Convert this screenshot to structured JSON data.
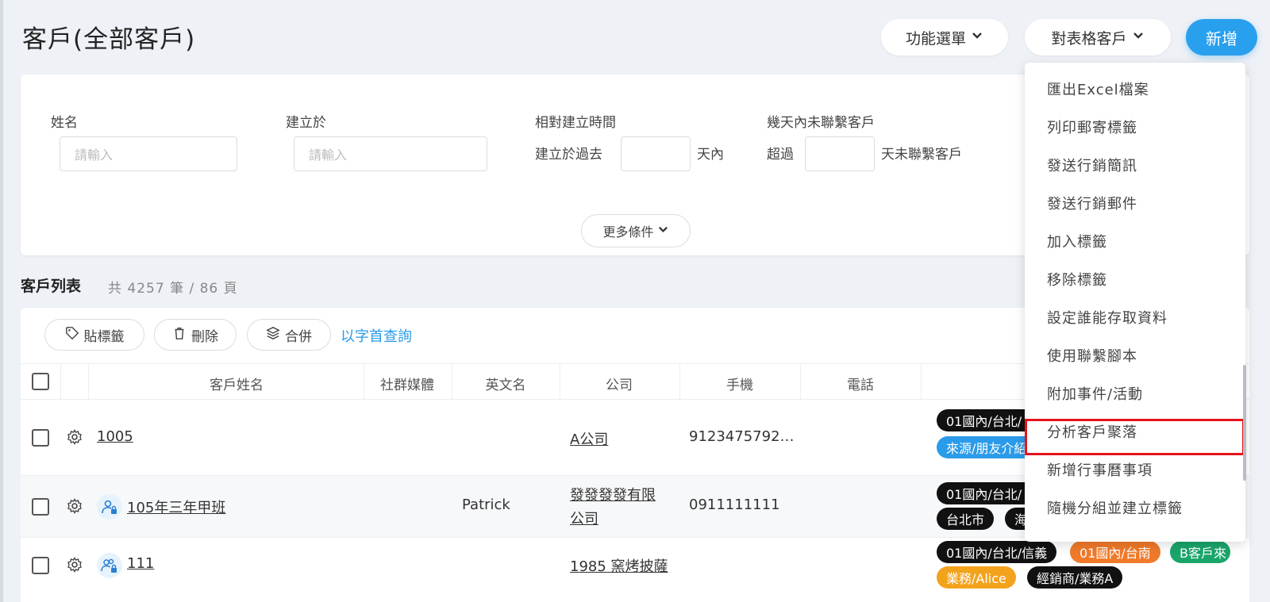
{
  "header": {
    "title": "客戶(全部客戶)",
    "func_menu_label": "功能選單",
    "table_menu_label": "對表格客戶",
    "add_label": "新增"
  },
  "filters": {
    "name_label": "姓名",
    "name_placeholder": "請輸入",
    "created_label": "建立於",
    "created_placeholder": "請輸入",
    "relative_label": "相對建立時間",
    "relative_prefix": "建立於過去",
    "relative_suffix": "天內",
    "uncontacted_label": "幾天內未聯繫客戶",
    "uncontacted_prefix": "超過",
    "uncontacted_suffix": "天未聯繫客戶",
    "more_label": "更多條件"
  },
  "list": {
    "title": "客戶列表",
    "count": "共 4257 筆 / 86 頁",
    "toolbar": {
      "tag_label": "貼標籤",
      "delete_label": "刪除",
      "merge_label": "合併",
      "alpha_label": "以字首查詢"
    },
    "columns": [
      "客戶姓名",
      "社群媒體",
      "英文名",
      "公司",
      "手機",
      "電話"
    ],
    "rows": [
      {
        "name": "1005",
        "english": "",
        "company": "A公司",
        "company_line2": "",
        "mobile": "9123475792…",
        "tags": [
          "01國內/台北/",
          "來源/朋友介紹"
        ]
      },
      {
        "name": "105年三年甲班",
        "english": "Patrick",
        "company": "發發發發有限",
        "company_line2": "公司",
        "mobile": "0911111111",
        "tags": [
          "01國內/台北/",
          "台北市",
          "海"
        ]
      },
      {
        "name": "111",
        "english": "",
        "company": "1985 窯烤披薩",
        "company_line2": "",
        "mobile": "",
        "tags": [
          "01國內/台北/信義",
          "01國內/台南",
          "B客戶來",
          "業務/Alice",
          "經銷商/業務A"
        ]
      }
    ]
  },
  "dropdown": {
    "items": [
      "匯出Excel檔案",
      "列印郵寄標籤",
      "發送行銷簡訊",
      "發送行銷郵件",
      "加入標籤",
      "移除標籤",
      "設定誰能存取資料",
      "使用聯繫腳本",
      "附加事件/活動",
      "分析客戶聚落",
      "新增行事曆事項",
      "隨機分組並建立標籤"
    ],
    "highlighted": "分析客戶聚落"
  },
  "colors": {
    "accent": "#29a0ee",
    "highlight_border": "#e5141b",
    "tag_black": "#111111",
    "tag_blue": "#2a9be8",
    "tag_orange": "#f07a2a",
    "tag_green": "#1aa56a",
    "tag_amber": "#f3a21c"
  },
  "icons": [
    "chevron-down-icon",
    "tag-icon",
    "trash-icon",
    "layers-icon",
    "gear-icon",
    "user-lock-icon",
    "users-lock-icon"
  ]
}
